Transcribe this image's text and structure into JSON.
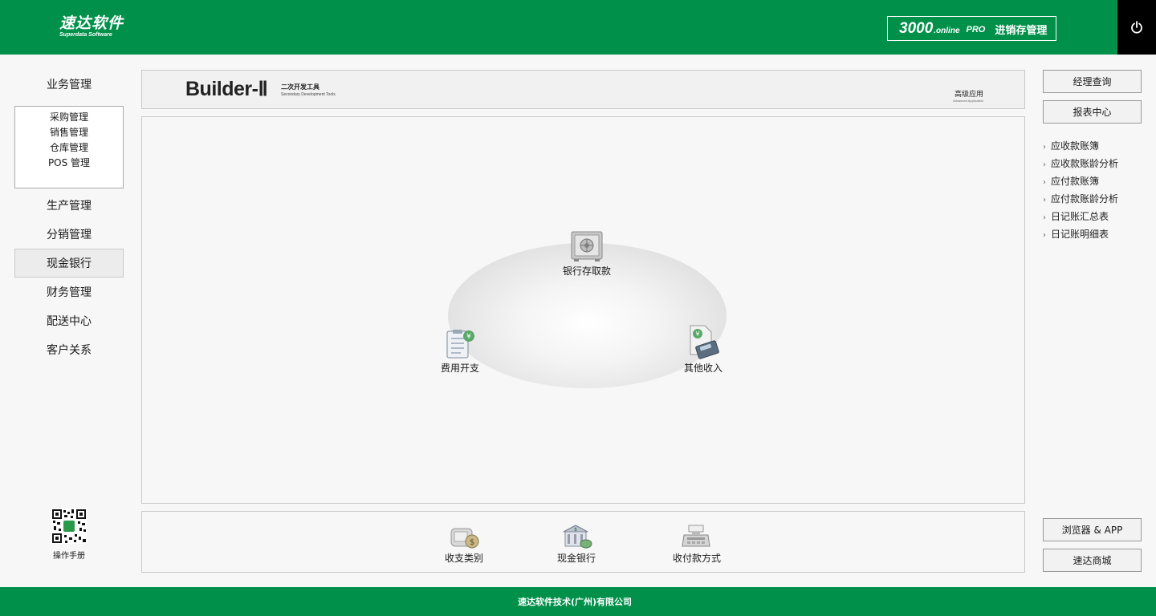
{
  "header": {
    "logo_cn": "速达软件",
    "logo_en": "Superdata Software",
    "product_num": "3000",
    "product_online": ".online",
    "product_pro": "PRO",
    "product_name": "进销存管理",
    "power_icon": "power-icon"
  },
  "nav": {
    "biz": "业务管理",
    "sub": [
      "采购管理",
      "销售管理",
      "仓库管理",
      "POS 管理"
    ],
    "items": [
      "生产管理",
      "分销管理",
      "现金银行",
      "财务管理",
      "配送中心",
      "客户关系"
    ],
    "active": "现金银行",
    "manual": "操作手册"
  },
  "banner": {
    "title": "Builder-Ⅱ",
    "sub_cn": "二次开发工具",
    "sub_en": "Secondary Development Tools",
    "right_cn": "高级应用",
    "right_en": "Advanced Application"
  },
  "workspace": {
    "nodes": [
      "银行存取款",
      "费用开支",
      "其他收入"
    ]
  },
  "bottom": {
    "items": [
      "收支类别",
      "现金银行",
      "收付款方式"
    ]
  },
  "right": {
    "btn_query": "经理查询",
    "btn_report": "报表中心",
    "links": [
      "应收款账簿",
      "应收款账龄分析",
      "应付款账簿",
      "应付款账龄分析",
      "日记账汇总表",
      "日记账明细表"
    ],
    "btn_browser": "浏览器 & APP",
    "btn_mall": "速达商城"
  },
  "footer": {
    "company": "速达软件技术(广州)有限公司"
  },
  "colors": {
    "brand_green": "#00904a",
    "power_bg": "#000000"
  }
}
